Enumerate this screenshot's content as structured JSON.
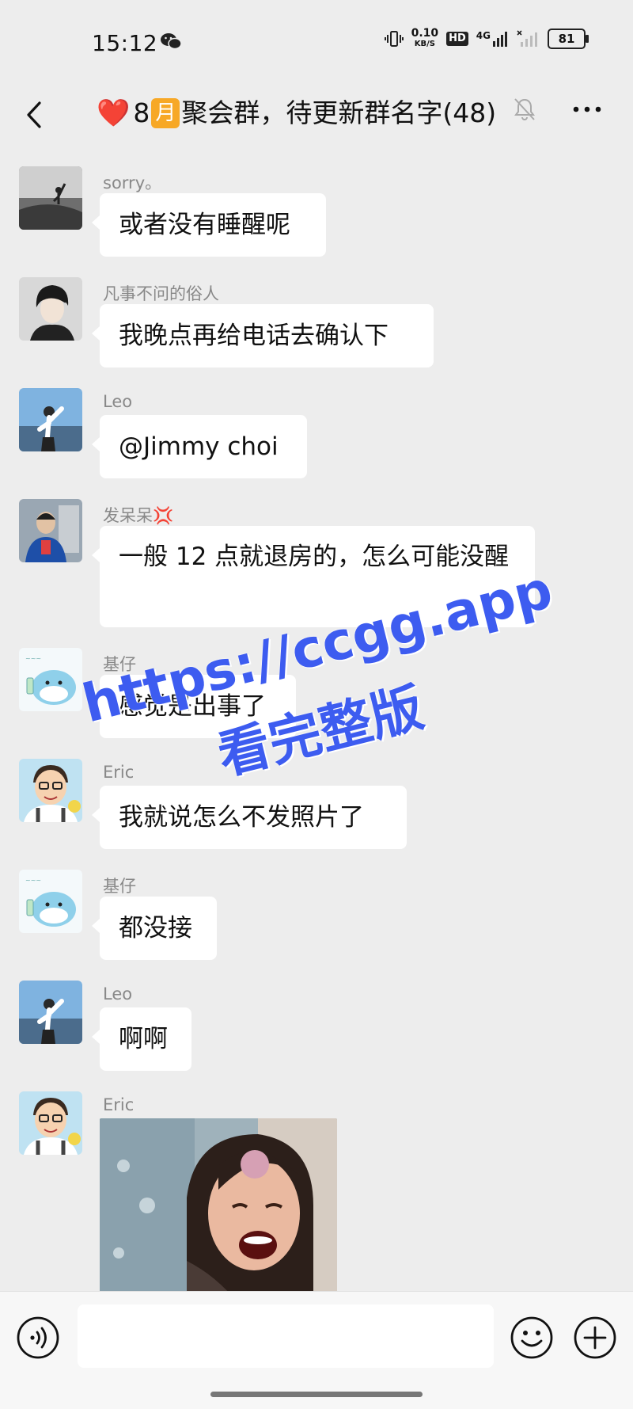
{
  "status_bar": {
    "time": "15:12",
    "speed_value": "0.10",
    "speed_unit": "KB/S",
    "hd_label": "HD",
    "network_label": "4G",
    "battery": "81"
  },
  "header": {
    "title_heart": "❤️",
    "title_number": "8",
    "title_month": "月",
    "title_text": "聚会群，待更新群名字(48)"
  },
  "messages": [
    {
      "sender": "sorry。",
      "text": "或者没有睡醒呢"
    },
    {
      "sender": "凡事不问的俗人",
      "text": "我晚点再给电话去确认下"
    },
    {
      "sender": "Leo",
      "text": "@Jimmy choi"
    },
    {
      "sender": "发呆呆💢",
      "text": "一般 12 点就退房的，怎么可能没醒"
    },
    {
      "sender": "基仔",
      "text": "感觉是出事了"
    },
    {
      "sender": "Eric",
      "text": "我就说怎么不发照片了"
    },
    {
      "sender": "基仔",
      "text": "都没接"
    },
    {
      "sender": "Leo",
      "text": "啊啊"
    },
    {
      "sender": "Eric",
      "text": ""
    }
  ],
  "watermark": {
    "line1": "https://ccgg.app",
    "line2": "看完整版"
  },
  "input": {
    "value": "",
    "placeholder": ""
  },
  "colors": {
    "background": "#ededed",
    "bubble": "#ffffff",
    "sender_name": "#888888",
    "watermark": "#3d5cf0",
    "month_badge": "#f7a826"
  }
}
